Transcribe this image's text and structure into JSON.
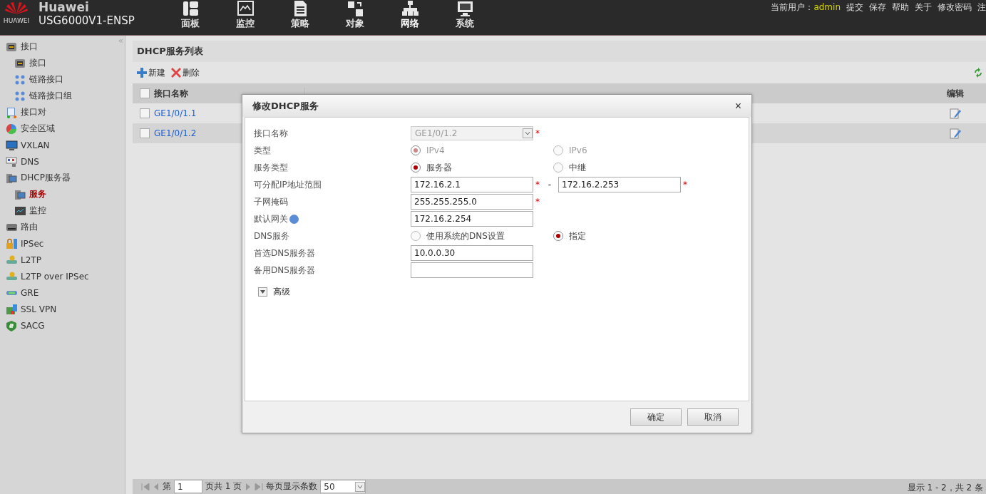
{
  "header": {
    "brand": "Huawei",
    "logo_text": "HUAWEI",
    "model": "USG6000V1-ENSP",
    "nav": [
      {
        "label": "面板",
        "selected": false
      },
      {
        "label": "监控",
        "selected": false
      },
      {
        "label": "策略",
        "selected": false
      },
      {
        "label": "对象",
        "selected": false
      },
      {
        "label": "网络",
        "selected": true
      },
      {
        "label": "系统",
        "selected": false
      }
    ],
    "user_label": "当前用户：",
    "user": "admin",
    "links": [
      "提交",
      "保存",
      "帮助",
      "关于",
      "修改密码",
      "注"
    ]
  },
  "sidebar": {
    "collapse": "«",
    "items": [
      {
        "label": "接口",
        "selected": false,
        "children": [
          {
            "label": "接口",
            "selected": false
          },
          {
            "label": "链路接口",
            "selected": false
          },
          {
            "label": "链路接口组",
            "selected": false
          }
        ]
      },
      {
        "label": "接口对",
        "selected": false
      },
      {
        "label": "安全区域",
        "selected": false
      },
      {
        "label": "VXLAN",
        "selected": false
      },
      {
        "label": "DNS",
        "selected": false
      },
      {
        "label": "DHCP服务器",
        "selected": false,
        "children": [
          {
            "label": "服务",
            "selected": true
          },
          {
            "label": "监控",
            "selected": false
          }
        ]
      },
      {
        "label": "路由",
        "selected": false
      },
      {
        "label": "IPSec",
        "selected": false
      },
      {
        "label": "L2TP",
        "selected": false
      },
      {
        "label": "L2TP over IPSec",
        "selected": false
      },
      {
        "label": "GRE",
        "selected": false
      },
      {
        "label": "SSL VPN",
        "selected": false
      },
      {
        "label": "SACG",
        "selected": false
      }
    ]
  },
  "panel": {
    "title": "DHCP服务列表",
    "toolbar": [
      {
        "label": "新建",
        "kind": "add"
      },
      {
        "label": "删除",
        "kind": "delete"
      }
    ],
    "all_checked": false,
    "columns": [
      "接口名称",
      "编辑"
    ],
    "rows": [
      {
        "name": "GE1/0/1.1",
        "checked": false
      },
      {
        "name": "GE1/0/1.2",
        "checked": false
      }
    ],
    "pager": {
      "page_prefix": "第",
      "page": "1",
      "page_suffix": "页共 1 页",
      "per_page_label": "每页显示条数",
      "per_page": "50",
      "summary": "显示 1 - 2，共 2 条"
    }
  },
  "dialog": {
    "title": "修改DHCP服务",
    "close": "×",
    "fields": [
      {
        "kind": "select",
        "label": "接口名称",
        "value": "GE1/0/1.2",
        "disabled": true,
        "required_mark": "*"
      },
      {
        "kind": "radio",
        "label": "类型",
        "options": [
          {
            "label": "IPv4",
            "selected": true
          },
          {
            "label": "IPv6",
            "selected": false
          }
        ],
        "disabled": true
      },
      {
        "kind": "radio",
        "label": "服务类型",
        "options": [
          {
            "label": "服务器",
            "selected": true
          },
          {
            "label": "中继",
            "selected": false
          }
        ],
        "disabled": false
      },
      {
        "kind": "range",
        "label": "可分配IP地址范围",
        "value": "172.16.2.1",
        "required_mark": "*",
        "separator": "-",
        "value_end": "172.16.2.253",
        "required_mark_end": "*"
      },
      {
        "kind": "text",
        "label": "子网掩码",
        "value": "255.255.255.0",
        "required_mark": "*"
      },
      {
        "kind": "text",
        "label": "默认网关",
        "value": "172.16.2.254",
        "help": true
      },
      {
        "kind": "radio",
        "label": "DNS服务",
        "options": [
          {
            "label": "使用系统的DNS设置",
            "selected": false
          },
          {
            "label": "指定",
            "selected": true
          }
        ],
        "disabled": false
      },
      {
        "kind": "text",
        "label": "首选DNS服务器",
        "value": "10.0.0.30"
      },
      {
        "kind": "text",
        "label": "备用DNS服务器"
      }
    ],
    "advanced": {
      "label": "高级",
      "expanded": false
    },
    "buttons": [
      "确定",
      "取消"
    ]
  }
}
